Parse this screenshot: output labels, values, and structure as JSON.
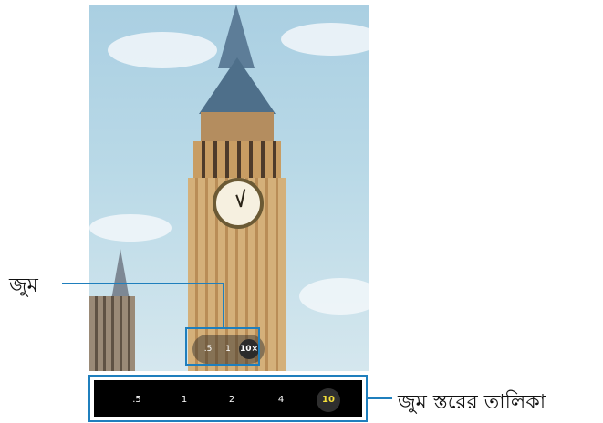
{
  "viewfinder": {
    "zoom_options": [
      {
        "label": ".5",
        "selected": false
      },
      {
        "label": "1",
        "selected": false
      },
      {
        "label": "10×",
        "selected": true
      }
    ]
  },
  "zoom_levels": [
    {
      "label": ".5",
      "selected": false
    },
    {
      "label": "1",
      "selected": false
    },
    {
      "label": "2",
      "selected": false
    },
    {
      "label": "4",
      "selected": false
    },
    {
      "label": "10",
      "selected": true
    }
  ],
  "callouts": {
    "zoom_label": "জুম",
    "zoom_list_label": "জুম স্তরের তালিকা"
  },
  "colors": {
    "callout": "#1f7fbd",
    "selected_zoom_text": "#f6e03a"
  }
}
